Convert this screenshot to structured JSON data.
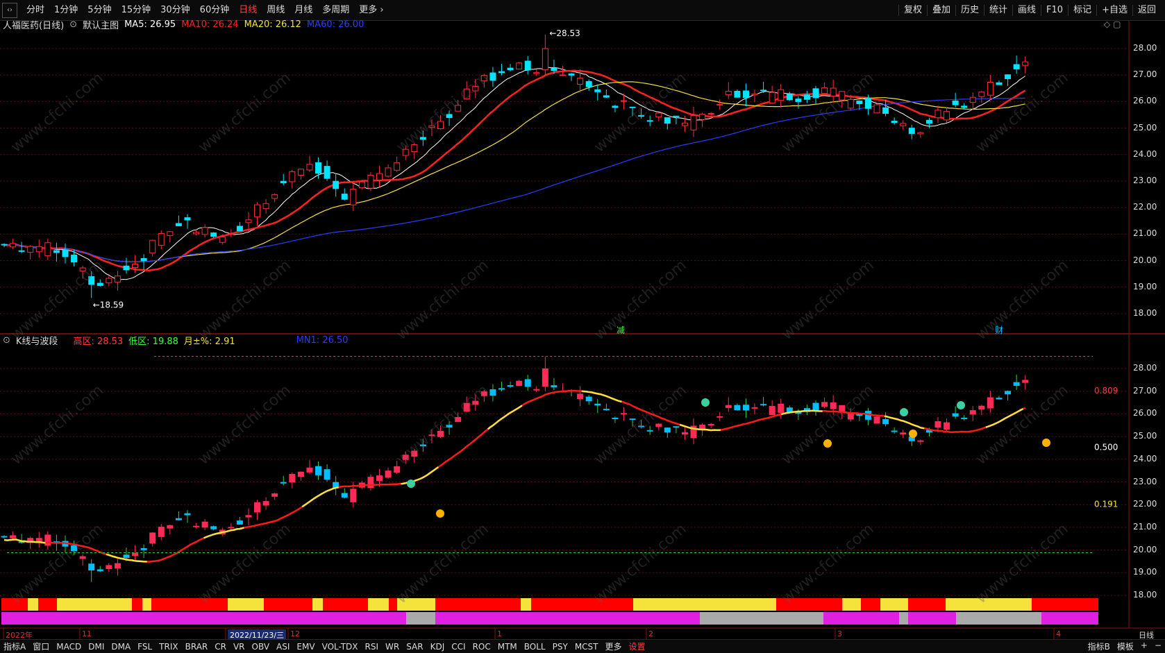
{
  "topbar": {
    "periods": [
      "分时",
      "1分钟",
      "5分钟",
      "15分钟",
      "30分钟",
      "60分钟",
      "日线",
      "周线",
      "月线",
      "多周期",
      "更多 ›"
    ],
    "active_period": "日线",
    "tools": [
      "复权",
      "叠加",
      "历史",
      "统计",
      "画线",
      "F10",
      "标记",
      "+自选",
      "返回"
    ]
  },
  "main_panel": {
    "stock_title": "人福医药(日线)",
    "template": "默认主图",
    "ma": [
      {
        "label": "MA5: 26.95",
        "color": "#ffffff"
      },
      {
        "label": "MA10: 26.24",
        "color": "#ff2020"
      },
      {
        "label": "MA20: 26.12",
        "color": "#f5e23a"
      },
      {
        "label": "MA60: 26.00",
        "color": "#2a3cff"
      }
    ],
    "high_marker": "28.53",
    "low_marker": "18.59",
    "event_markers": [
      "减",
      "财"
    ],
    "y_ticks": [
      "28.00",
      "27.00",
      "26.00",
      "25.00",
      "24.00",
      "23.00",
      "22.00",
      "21.00",
      "20.00",
      "19.00",
      "18.00"
    ]
  },
  "sub_panel": {
    "name": "K线与波段",
    "high_label": "高区: 28.53",
    "low_label": "低区: 19.88",
    "month_label": "月±%: 2.91",
    "mn_label": "MN1: 26.50",
    "fib_labels": [
      "0.809",
      "0.500",
      "0.191"
    ],
    "y_ticks": [
      "28.00",
      "27.00",
      "26.00",
      "25.00",
      "24.00",
      "23.00",
      "22.00",
      "21.00",
      "20.00",
      "19.00",
      "18.00"
    ]
  },
  "date_axis": {
    "labels": [
      "2022年",
      "11",
      "2022/11/23/三",
      "12",
      "1",
      "2",
      "3",
      "4"
    ],
    "right_label": "日线"
  },
  "bottombar": {
    "tabs": [
      "指标A",
      "窗口",
      "MACD",
      "DMI",
      "DMA",
      "FSL",
      "TRIX",
      "BRAR",
      "CR",
      "VR",
      "OBV",
      "ASI",
      "EMV",
      "VOL-TDX",
      "RSI",
      "WR",
      "SAR",
      "KDJ",
      "CCI",
      "ROC",
      "MTM",
      "BOLL",
      "PSY",
      "MCST",
      "更多"
    ],
    "settings": "设置",
    "right_tabs": [
      "指标B",
      "模板",
      "+",
      "−"
    ]
  },
  "watermark": "www.cfchi.com",
  "colors": {
    "up": "#ff2a3a",
    "down": "#00e5ff",
    "ma5": "#ffffff",
    "ma10": "#ff2020",
    "ma20": "#f5e23a",
    "ma60": "#2a3cff",
    "magenta": "#e020e0"
  }
}
